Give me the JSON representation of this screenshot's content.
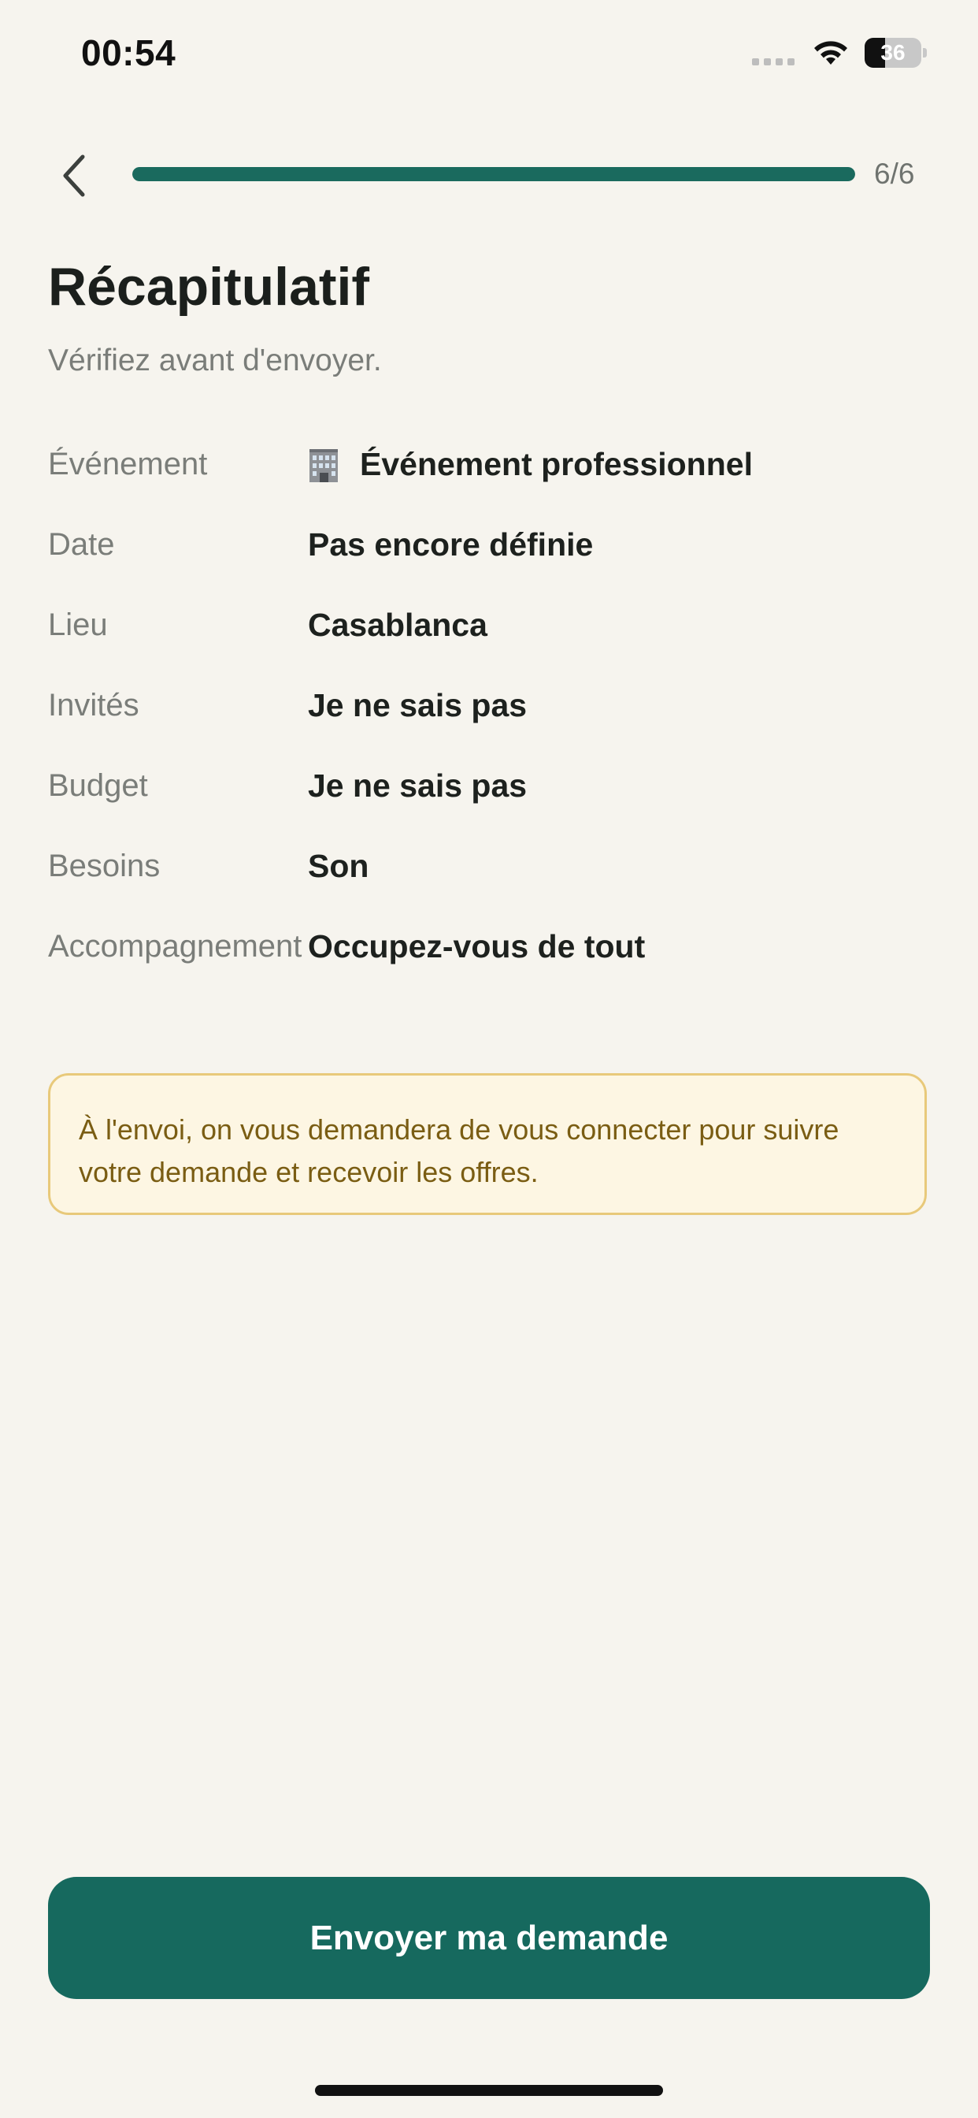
{
  "status_bar": {
    "time": "00:54",
    "battery_level": "36",
    "battery_fraction": 0.36
  },
  "header": {
    "back_icon": "chevron-left-icon",
    "progress_fraction": 1.0,
    "step_counter": "6/6"
  },
  "page": {
    "title": "Récapitulatif",
    "subtitle": "Vérifiez avant d'envoyer."
  },
  "summary": [
    {
      "label": "Événement",
      "value": "Événement professionnel",
      "icon": "building-icon"
    },
    {
      "label": "Date",
      "value": "Pas encore définie"
    },
    {
      "label": "Lieu",
      "value": "Casablanca"
    },
    {
      "label": "Invités",
      "value": "Je ne sais pas"
    },
    {
      "label": "Budget",
      "value": "Je ne sais pas"
    },
    {
      "label": "Besoins",
      "value": "Son"
    },
    {
      "label": "Accompagnement",
      "value": "Occupez-vous de tout"
    }
  ],
  "info_box": {
    "text": "À l'envoi, on vous demandera de vous connecter pour suivre votre demande et recevoir les offres."
  },
  "submit": {
    "label": "Envoyer ma demande"
  },
  "colors": {
    "background": "#f6f4ee",
    "accent": "#16695e",
    "info_border": "#e8c97a",
    "info_background": "#fdf6e3",
    "info_text": "#7a5d13"
  }
}
